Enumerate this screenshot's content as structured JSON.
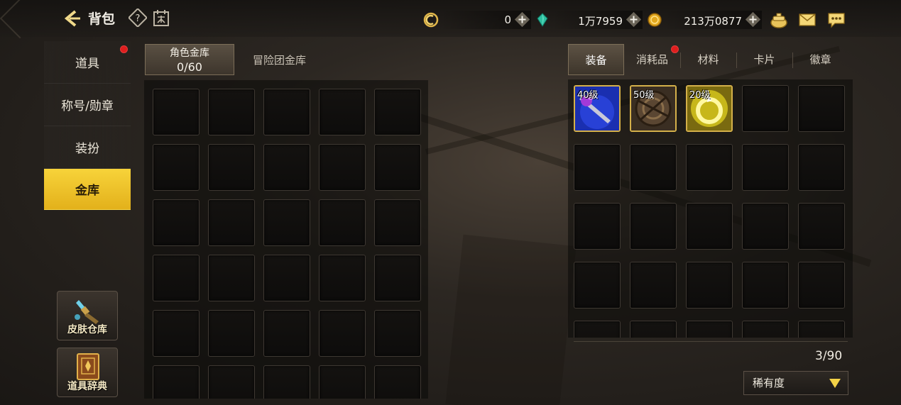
{
  "header": {
    "title": "背包",
    "currencies": [
      {
        "name": "coupon",
        "value": "0"
      },
      {
        "name": "gem",
        "value": "1万7959"
      },
      {
        "name": "gold",
        "value": "213万0877"
      }
    ]
  },
  "sidebar": {
    "items": [
      {
        "label": "道具",
        "badge": true
      },
      {
        "label": "称号/勋章",
        "badge": false
      },
      {
        "label": "装扮",
        "badge": false
      },
      {
        "label": "金库",
        "badge": false,
        "active": true
      }
    ],
    "skin_storage_label": "皮肤仓库",
    "item_dictionary_label": "道具辞典"
  },
  "storage": {
    "tab_character_label": "角色金库",
    "tab_character_count": "0/60",
    "tab_adventure_label": "冒险团金库"
  },
  "inventory": {
    "tabs": [
      {
        "label": "装备",
        "active": true,
        "badge": false
      },
      {
        "label": "消耗品",
        "active": false,
        "badge": true
      },
      {
        "label": "材料",
        "active": false,
        "badge": false
      },
      {
        "label": "卡片",
        "active": false,
        "badge": false
      },
      {
        "label": "徽章",
        "active": false,
        "badge": false
      }
    ],
    "items": [
      {
        "level": "40级",
        "icon": "purple-weapon-icon"
      },
      {
        "level": "50级",
        "icon": "bronze-armor-icon"
      },
      {
        "level": "20级",
        "icon": "gold-ring-icon"
      }
    ],
    "count": "3/90",
    "sort_label": "稀有度"
  },
  "colors": {
    "accent": "#f2c92e",
    "badge": "#e01e1e",
    "item_border": "#d4b04a"
  }
}
